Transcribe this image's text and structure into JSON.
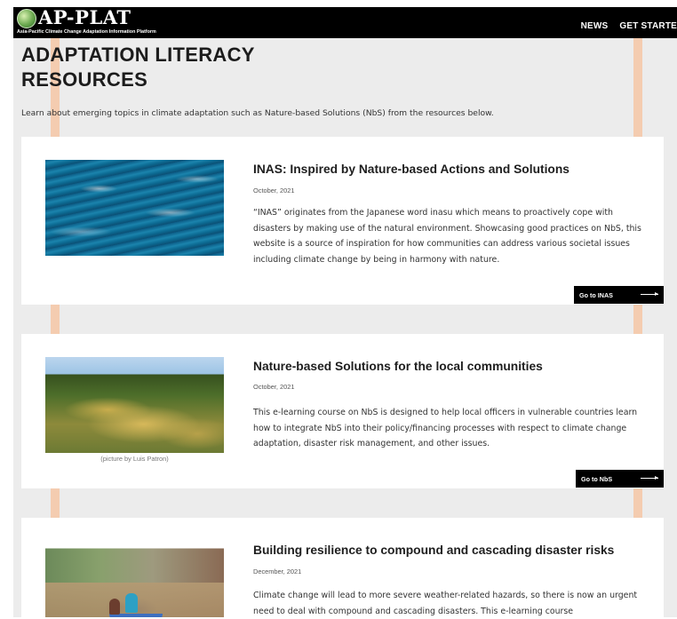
{
  "header": {
    "logo_text": "AP-PLAT",
    "logo_subtitle": "Asia-Pacific Climate Change Adaptation Information Platform",
    "nav": [
      "NEWS",
      "GET STARTE"
    ]
  },
  "page": {
    "title": "ADAPTATION LITERACY RESOURCES",
    "intro": "Learn about emerging topics in climate adaptation such as Nature-based Solutions (NbS) from the resources below."
  },
  "cards": [
    {
      "title": "INAS: Inspired by Nature-based Actions and Solutions",
      "date": "October, 2021",
      "description": "“INAS” originates from the Japanese word inasu which means to proactively cope with disasters by making use of the natural environment. Showcasing good practices on NbS, this website is a source of inspiration for how communities can address various societal issues including climate change by being in harmony with nature.",
      "button": "Go to INAS",
      "image": "ocean-waves-image"
    },
    {
      "title": "Nature-based Solutions for the local communities",
      "date": "October, 2021",
      "description": "This e-learning course on NbS is designed to help local officers in vulnerable countries learn how to integrate NbS into their policy/financing processes with respect to climate change adaptation, disaster risk management, and other issues.",
      "caption": "(picture by Luis Patron)",
      "button": "Go to NbS",
      "image": "rice-terraces-image"
    },
    {
      "title": "Building resilience to compound and cascading disaster risks",
      "date": "December, 2021",
      "description": "Climate change will lead to more severe weather-related hazards, so there is now an urgent need to deal with compound and cascading disasters. This e-learning course",
      "image": "flood-boat-image"
    }
  ],
  "colors": {
    "header_bg": "#000000",
    "stripe": "#f4ccb0",
    "page_bg": "#ececec",
    "card_bg": "#ffffff",
    "button_bg": "#000000"
  }
}
